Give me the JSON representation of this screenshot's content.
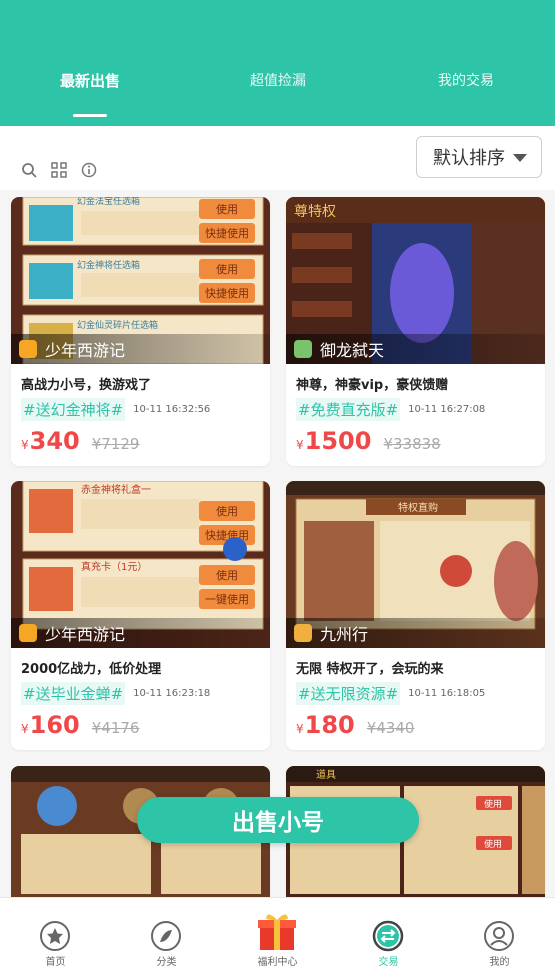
{
  "tabs": [
    {
      "label": "最新出售",
      "active": true
    },
    {
      "label": "超值捡漏",
      "active": false
    },
    {
      "label": "我的交易",
      "active": false
    }
  ],
  "toolbar": {
    "icons": [
      "search-icon",
      "grid-icon",
      "info-icon"
    ],
    "sort_label": "默认排序"
  },
  "colors": {
    "accent": "#2ec4a8",
    "price": "#f04848"
  },
  "listings": [
    {
      "game": "少年西游记",
      "title": "高战力小号，换游戏了",
      "tag": "#送幻金神将#",
      "time": "10-11 16:32:56",
      "currency": "¥",
      "price": "340",
      "original": "¥7129"
    },
    {
      "game": "御龙弑天",
      "title": "神尊，神豪vip，豪侠馈赠",
      "tag": "#免费直充版#",
      "time": "10-11 16:27:08",
      "currency": "¥",
      "price": "1500",
      "original": "¥33838"
    },
    {
      "game": "少年西游记",
      "title": "2000亿战力，低价处理",
      "tag": "#送毕业金蝉#",
      "time": "10-11 16:23:18",
      "currency": "¥",
      "price": "160",
      "original": "¥4176"
    },
    {
      "game": "九州行",
      "title": "无限 特权开了，会玩的来",
      "tag": "#送无限资源#",
      "time": "10-11 16:18:05",
      "currency": "¥",
      "price": "180",
      "original": "¥4340"
    }
  ],
  "thumbs": {
    "t1": [
      "幻金法宝任选箱",
      "幻金神将任选箱",
      "幻金仙灵碎片任选箱",
      "使用",
      "快捷使用",
      "使用",
      "快捷使用"
    ],
    "t2": [
      "尊特权"
    ],
    "t3": [
      "赤金神将礼盒一",
      "真充卡（1元）",
      "使用",
      "快捷使用",
      "使用",
      "一键使用"
    ],
    "t4": [
      "特权直购"
    ],
    "t6": [
      "道具",
      "使用",
      "使用"
    ]
  },
  "sell_button": "出售小号",
  "bottom_nav": [
    {
      "label": "首页",
      "icon": "star-icon"
    },
    {
      "label": "分类",
      "icon": "compass-icon"
    },
    {
      "label": "福利中心",
      "icon": "gift-icon"
    },
    {
      "label": "交易",
      "icon": "exchange-icon",
      "active": true
    },
    {
      "label": "我的",
      "icon": "user-icon"
    }
  ]
}
